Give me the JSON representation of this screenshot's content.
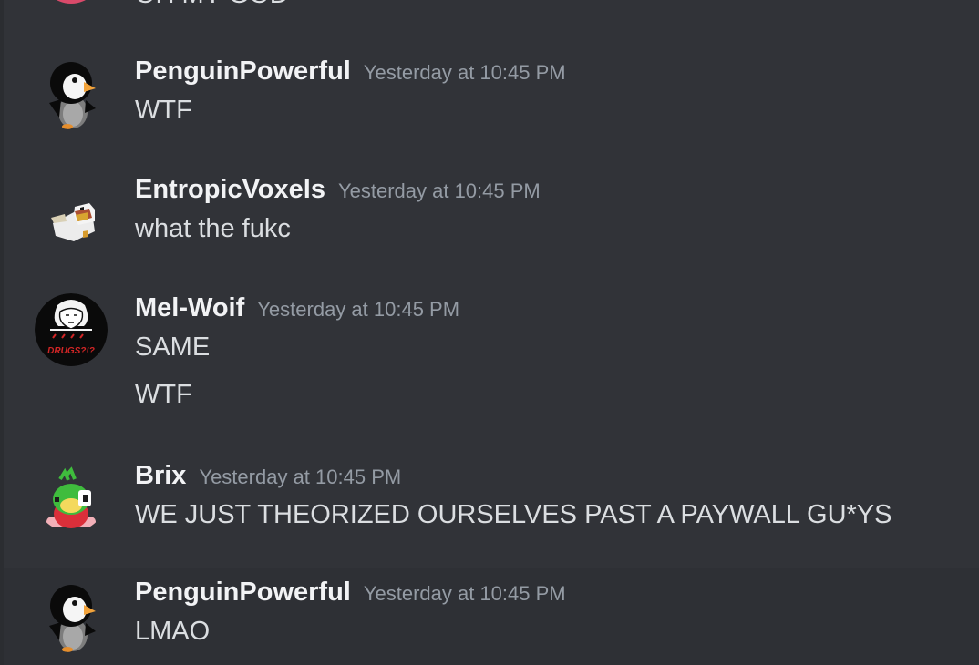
{
  "previous_message": {
    "content": "OH MY GOD"
  },
  "messages": [
    {
      "author": "PenguinPowerful",
      "timestamp": "Yesterday at 10:45 PM",
      "lines": [
        "WTF"
      ],
      "avatar_icon": "penguin-avatar-icon"
    },
    {
      "author": "EntropicVoxels",
      "timestamp": "Yesterday at 10:45 PM",
      "lines": [
        "what the fukc"
      ],
      "avatar_icon": "voxel-duck-avatar-icon"
    },
    {
      "author": "Mel-Woif",
      "timestamp": "Yesterday at 10:45 PM",
      "lines": [
        "SAME",
        "WTF"
      ],
      "avatar_icon": "drugs-sketch-avatar-icon",
      "avatar_text": "DRUGS?!?"
    },
    {
      "author": "Brix",
      "timestamp": "Yesterday at 10:45 PM",
      "lines": [
        "WE JUST THEORIZED OURSELVES PAST A PAYWALL GU*YS"
      ],
      "avatar_icon": "green-dragon-avatar-icon"
    },
    {
      "author": "PenguinPowerful",
      "timestamp": "Yesterday at 10:45 PM",
      "lines": [
        "LMAO"
      ],
      "avatar_icon": "penguin-avatar-icon"
    }
  ],
  "colors": {
    "background": "#313338",
    "author": "#f2f3f5",
    "timestamp": "#949ba4",
    "message_text": "#dbdee1"
  }
}
